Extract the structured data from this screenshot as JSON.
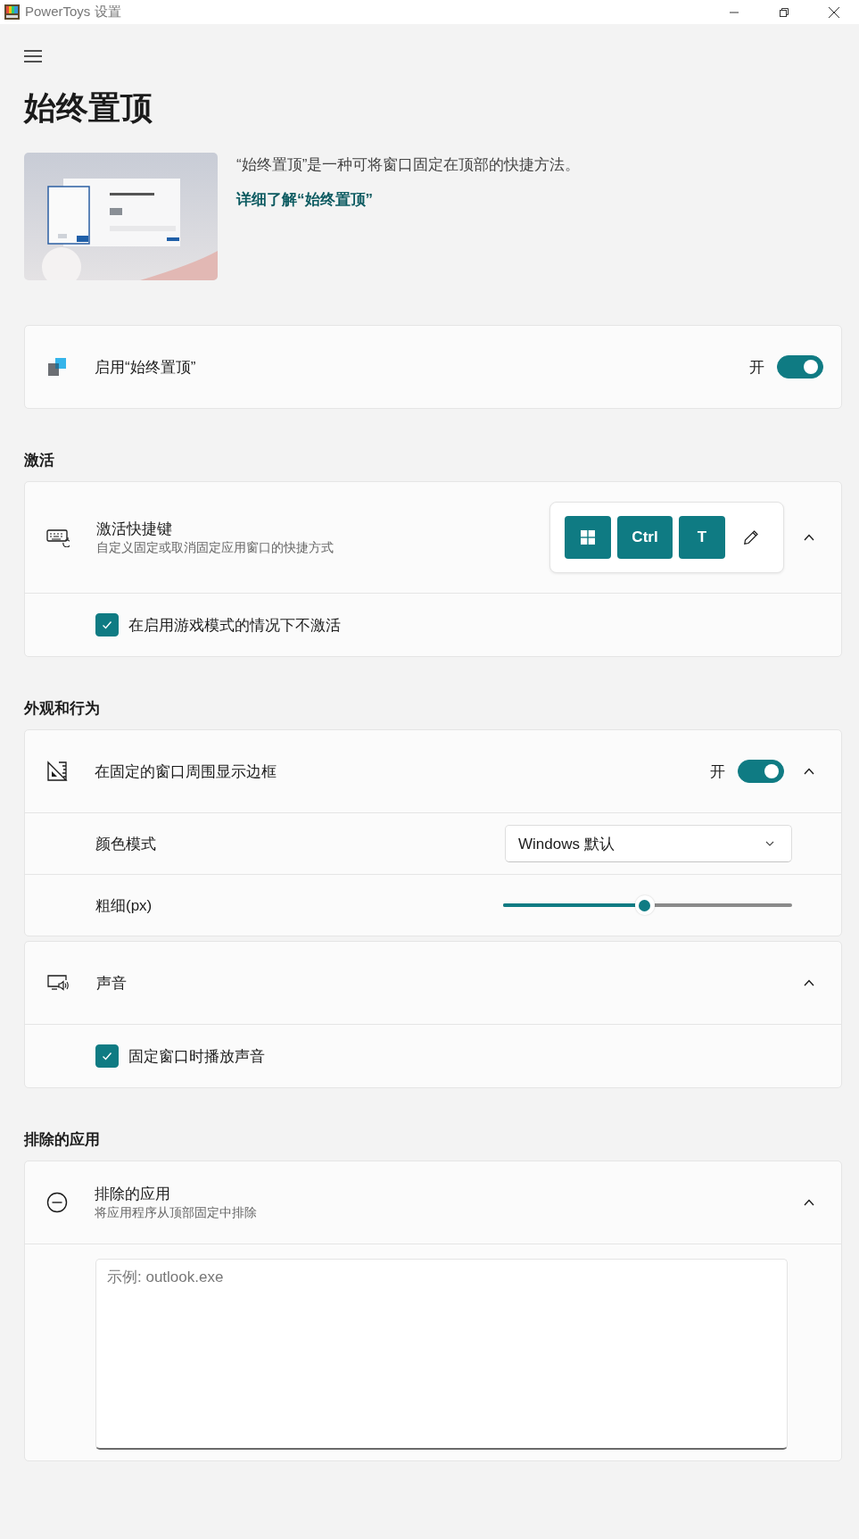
{
  "window": {
    "title": "PowerToys 设置"
  },
  "page": {
    "title": "始终置顶",
    "description": "“始终置顶”是一种可将窗口固定在顶部的快捷方法。",
    "learn_more": "详细了解“始终置顶”"
  },
  "enable": {
    "label": "启用“始终置顶”",
    "state_text": "开",
    "on": true
  },
  "activation": {
    "heading": "激活",
    "shortcut": {
      "label": "激活快捷键",
      "description": "自定义固定或取消固定应用窗口的快捷方式",
      "expanded": true,
      "keys": [
        {
          "kind": "windows"
        },
        {
          "kind": "text",
          "label": "Ctrl"
        },
        {
          "kind": "text",
          "label": "T"
        }
      ]
    },
    "game_mode": {
      "label": "在启用游戏模式的情况下不激活",
      "checked": true
    }
  },
  "appearance": {
    "heading": "外观和行为",
    "border": {
      "label": "在固定的窗口周围显示边框",
      "state_text": "开",
      "on": true,
      "expanded": true
    },
    "color_mode": {
      "label": "颜色模式",
      "value": "Windows 默认"
    },
    "thickness": {
      "label": "粗细(px)",
      "level": 0.49
    },
    "sound": {
      "label": "声音",
      "expanded": true,
      "checkbox": {
        "label": "固定窗口时播放声音",
        "checked": true
      }
    }
  },
  "excluded": {
    "heading": "排除的应用",
    "label": "排除的应用",
    "description": "将应用程序从顶部固定中排除",
    "expanded": true,
    "textarea": {
      "placeholder": "示例: outlook.exe"
    }
  }
}
